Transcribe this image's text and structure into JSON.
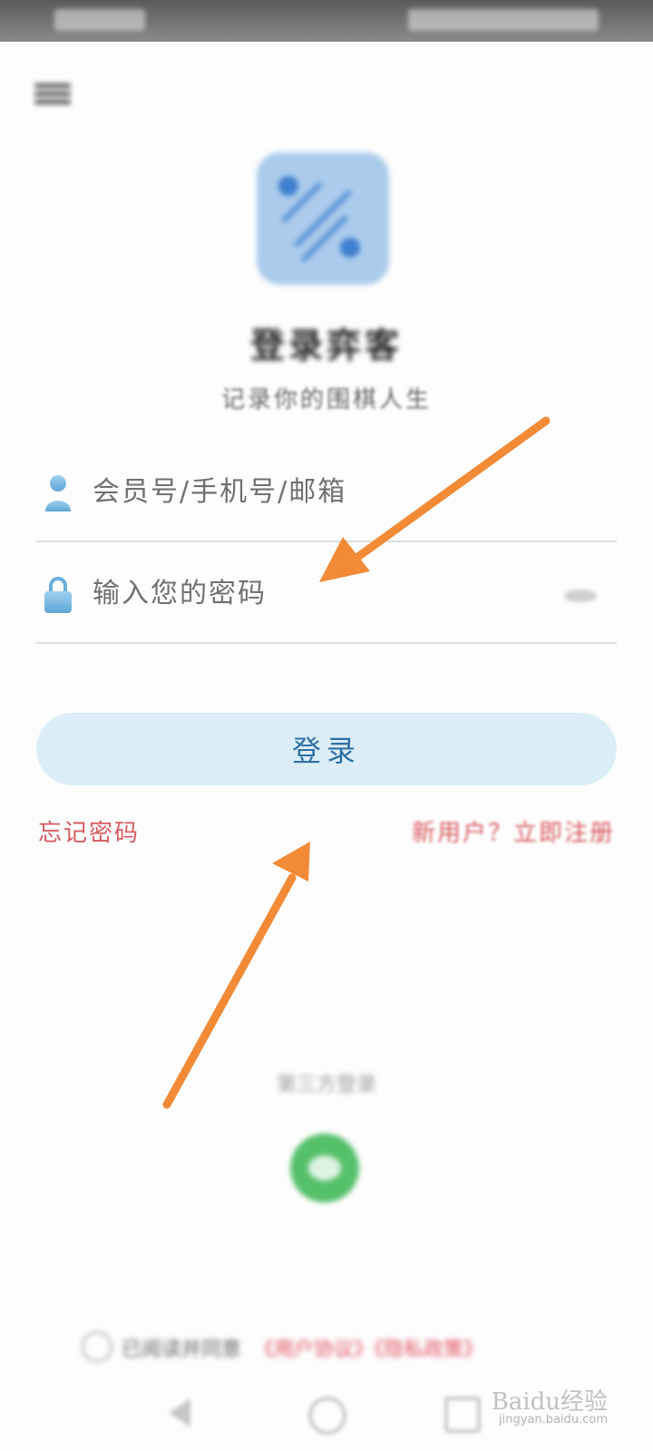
{
  "status_bar": {
    "left": "",
    "right": ""
  },
  "header": {
    "menu_icon": "menu-icon"
  },
  "app": {
    "title": "登录弈客",
    "subtitle": "记录你的围棋人生"
  },
  "form": {
    "username_placeholder": "会员号/手机号/邮箱",
    "password_placeholder": "输入您的密码",
    "login_label": "登录",
    "forgot_label": "忘记密码",
    "register_label": "新用户？立即注册"
  },
  "other_login": {
    "label": "第三方登录"
  },
  "agreement": {
    "text": "已阅读并同意",
    "links": "《用户协议》《隐私政策》"
  },
  "watermark": {
    "brand": "Baidu经验",
    "url": "jingyan.baidu.com"
  },
  "colors": {
    "accent": "#2f6ea5",
    "login_button_bg": "#dbeef7",
    "link_red": "#d85a5f",
    "arrow": "#f28a36",
    "wechat_green": "#55c06a"
  }
}
